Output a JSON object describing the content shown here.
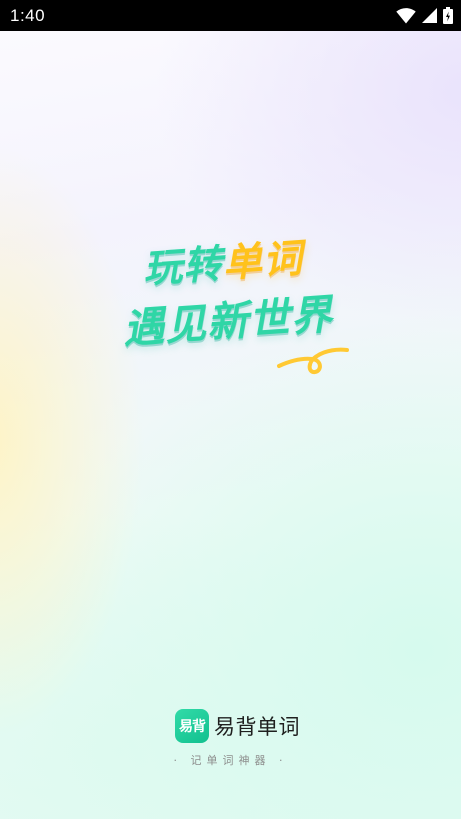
{
  "status_bar": {
    "time": "1:40",
    "icons": [
      "wifi-icon",
      "cell-signal-icon",
      "battery-icon"
    ]
  },
  "slogan": {
    "line1_part1": "玩转",
    "line1_part2": "单词",
    "line2": "遇见新世界"
  },
  "brand": {
    "logo_text": "易背",
    "app_name": "易背单词",
    "tagline": "· 记单词神器 ·"
  },
  "colors": {
    "teal": "#2fd6a6",
    "yellow": "#ffc21c",
    "logo_green": "#1ccc98",
    "status_bar": "#000000"
  }
}
